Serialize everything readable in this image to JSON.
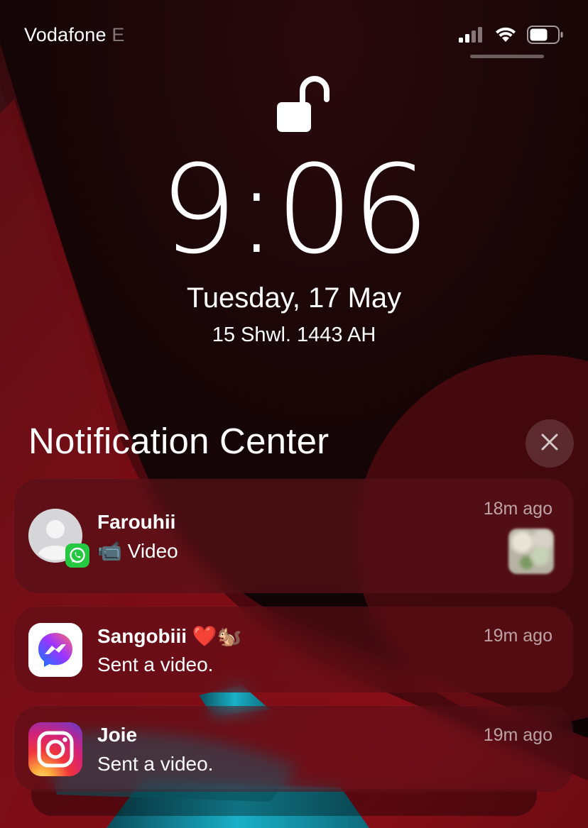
{
  "status_bar": {
    "carrier": "Vodafone",
    "carrier_extra": "E",
    "signal_icon": "cellular-signal-icon",
    "wifi_icon": "wifi-icon",
    "battery_icon": "battery-icon"
  },
  "lock": {
    "icon": "unlocked-padlock-icon"
  },
  "clock": {
    "time": "9:06"
  },
  "date": {
    "gregorian": "Tuesday, 17 May",
    "hijri": "15 Shwl. 1443 AH"
  },
  "notification_center": {
    "title": "Notification Center",
    "close_icon": "close-icon",
    "notifications": [
      {
        "app": "WhatsApp",
        "icon": "whatsapp-icon",
        "title": "Farouhii",
        "body": "📹 Video",
        "time": "18m ago"
      },
      {
        "app": "Messenger",
        "icon": "messenger-icon",
        "title": "Sangobiii ❤️🐿️",
        "body": "Sent a video.",
        "time": "19m ago"
      },
      {
        "app": "Instagram",
        "icon": "instagram-icon",
        "title": "Joie",
        "body": "Sent a video.",
        "time": "19m ago"
      }
    ]
  },
  "colors": {
    "accent_red": "#b3121f",
    "accent_cyan": "#1fb3c8",
    "background_dark": "#120607"
  }
}
